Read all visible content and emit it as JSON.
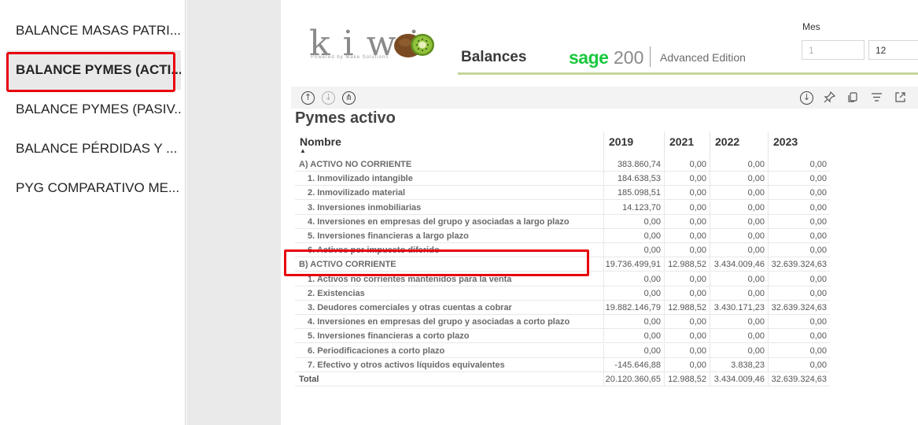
{
  "sidebar": {
    "items": [
      {
        "label": "BALANCE MASAS PATRI..."
      },
      {
        "label": "BALANCE PYMES (ACTI..."
      },
      {
        "label": "BALANCE PYMES (PASIV..."
      },
      {
        "label": "BALANCE PÉRDIDAS Y ..."
      },
      {
        "label": "PYG COMPARATIVO ME..."
      }
    ],
    "active_index": 1
  },
  "header": {
    "logo_text": "kiwi",
    "logo_sub": "Powered by Make Solutions",
    "title": "Balances",
    "brand": "sage",
    "version": "200",
    "edition": "Advanced Edition"
  },
  "slicer": {
    "label": "Mes",
    "from": "1",
    "to": "12"
  },
  "visual": {
    "title": "Pymes activo",
    "columns": [
      "Nombre",
      "2019",
      "2021",
      "2022",
      "2023"
    ],
    "rows": [
      {
        "name": "A) ACTIVO NO CORRIENTE",
        "v2019": "383.860,74",
        "v2021": "0,00",
        "v2022": "0,00",
        "v2023": "0,00"
      },
      {
        "name": "1. Inmovilizado intangible",
        "v2019": "184.638,53",
        "v2021": "0,00",
        "v2022": "0,00",
        "v2023": "0,00"
      },
      {
        "name": "2. Inmovilizado material",
        "v2019": "185.098,51",
        "v2021": "0,00",
        "v2022": "0,00",
        "v2023": "0,00"
      },
      {
        "name": "3. Inversiones inmobiliarias",
        "v2019": "14.123,70",
        "v2021": "0,00",
        "v2022": "0,00",
        "v2023": "0,00"
      },
      {
        "name": "4. Inversiones en empresas del grupo y asociadas a largo plazo",
        "v2019": "0,00",
        "v2021": "0,00",
        "v2022": "0,00",
        "v2023": "0,00"
      },
      {
        "name": "5. Inversiones financieras a largo plazo",
        "v2019": "0,00",
        "v2021": "0,00",
        "v2022": "0,00",
        "v2023": "0,00"
      },
      {
        "name": "6. Activos por impuesto diferido",
        "v2019": "0,00",
        "v2021": "0,00",
        "v2022": "0,00",
        "v2023": "0,00"
      },
      {
        "name": "B) ACTIVO CORRIENTE",
        "v2019": "19.736.499,91",
        "v2021": "12.988,52",
        "v2022": "3.434.009,46",
        "v2023": "32.639.324,63"
      },
      {
        "name": "1. Activos no corrientes mantenidos para la venta",
        "v2019": "0,00",
        "v2021": "0,00",
        "v2022": "0,00",
        "v2023": "0,00"
      },
      {
        "name": "2. Existencias",
        "v2019": "0,00",
        "v2021": "0,00",
        "v2022": "0,00",
        "v2023": "0,00"
      },
      {
        "name": "3. Deudores comerciales y otras cuentas a cobrar",
        "v2019": "19.882.146,79",
        "v2021": "12.988,52",
        "v2022": "3.430.171,23",
        "v2023": "32.639.324,63"
      },
      {
        "name": "4. Inversiones en empresas del grupo y asociadas a corto plazo",
        "v2019": "0,00",
        "v2021": "0,00",
        "v2022": "0,00",
        "v2023": "0,00"
      },
      {
        "name": "5. Inversiones financieras a corto plazo",
        "v2019": "0,00",
        "v2021": "0,00",
        "v2022": "0,00",
        "v2023": "0,00"
      },
      {
        "name": "6. Periodificaciones a corto plazo",
        "v2019": "0,00",
        "v2021": "0,00",
        "v2022": "0,00",
        "v2023": "0,00"
      },
      {
        "name": "7. Efectivo y otros activos líquidos equivalentes",
        "v2019": "-145.646,88",
        "v2021": "0,00",
        "v2022": "3.838,23",
        "v2023": "0,00"
      }
    ],
    "total": {
      "name": "Total",
      "v2019": "20.120.360,65",
      "v2021": "12.988,52",
      "v2022": "3.434.009,46",
      "v2023": "32.639.324,63"
    }
  },
  "colors": {
    "highlight": "#e8000b",
    "sage_green": "#1ac83e",
    "accent_line": "#c3d69b"
  },
  "icons": [
    "drill-up-icon",
    "drill-down-icon",
    "expand-hierarchy-icon",
    "drill-mode-icon",
    "pin-icon",
    "copy-icon",
    "filter-icon",
    "focus-mode-icon"
  ]
}
